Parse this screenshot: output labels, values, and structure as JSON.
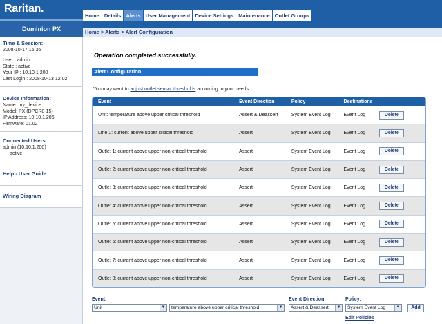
{
  "brand": {
    "logo_text": "Raritan.",
    "device_name": "Dominion PX"
  },
  "nav": {
    "tabs": [
      "Home",
      "Details",
      "Alerts",
      "User Management",
      "Device Settings",
      "Maintenance",
      "Outlet Groups"
    ],
    "active_tab": "Alerts"
  },
  "breadcrumb": {
    "home": "Home",
    "alerts": "Alerts",
    "current": "Alert Configuration",
    "sep": ">"
  },
  "sidebar": {
    "time_session": {
      "title": "Time & Session:",
      "datetime": "2008-10-17 15:36",
      "user": "User : admin",
      "state": "State : active",
      "ip": "Your IP : 10.10.1.200",
      "last_login": "Last Login : 2008-10-13 12:02"
    },
    "device_info": {
      "title": "Device Information:",
      "name": "Name: my_device",
      "model": "Model: PX (DPCR8-15)",
      "ip": "IP Address: 10.10.1.206",
      "firmware": "Firmware: 01.02"
    },
    "connected_users": {
      "title": "Connected Users:",
      "user": "admin (10.10.1.200)",
      "state": "active"
    },
    "help_link": "Help - User Guide",
    "wiring_link": "Wiring Diagram"
  },
  "main": {
    "operation_message": "Operation completed successfully.",
    "section_title": "Alert Configuration",
    "note_prefix": "You may want to ",
    "note_link": "adjust outlet sensor thresholds",
    "note_suffix": " according to your needs."
  },
  "table": {
    "headers": [
      "Event",
      "Event Direction",
      "Policy",
      "Destinations"
    ],
    "delete_label": "Delete",
    "rows": [
      {
        "event": "Unit: temperature above upper critical threshold",
        "direction": "Assert & Deassert",
        "policy": "System Event Log",
        "destination": "Event Log"
      },
      {
        "event": "Line 1: current above upper critical threshold",
        "direction": "Assert",
        "policy": "System Event Log",
        "destination": "Event Log"
      },
      {
        "event": "Outlet 1: current above upper non-critical threshold",
        "direction": "Assert",
        "policy": "System Event Log",
        "destination": "Event Log"
      },
      {
        "event": "Outlet 2: current above upper non-critical threshold",
        "direction": "Assert",
        "policy": "System Event Log",
        "destination": "Event Log"
      },
      {
        "event": "Outlet 3: current above upper non-critical threshold",
        "direction": "Assert",
        "policy": "System Event Log",
        "destination": "Event Log"
      },
      {
        "event": "Outlet 4: current above upper non-critical threshold",
        "direction": "Assert",
        "policy": "System Event Log",
        "destination": "Event Log"
      },
      {
        "event": "Outlet 5: current above upper non-critical threshold",
        "direction": "Assert",
        "policy": "System Event Log",
        "destination": "Event Log"
      },
      {
        "event": "Outlet 6: current above upper non-critical threshold",
        "direction": "Assert",
        "policy": "System Event Log",
        "destination": "Event Log"
      },
      {
        "event": "Outlet 7: current above upper non-critical threshold",
        "direction": "Assert",
        "policy": "System Event Log",
        "destination": "Event Log"
      },
      {
        "event": "Outlet 8: current above upper non-critical threshold",
        "direction": "Assert",
        "policy": "System Event Log",
        "destination": "Event Log"
      }
    ]
  },
  "form": {
    "event_label": "Event:",
    "event_source_value": "Unit",
    "event_value": "temperature above upper critical threshold",
    "direction_label": "Event Direction:",
    "direction_value": "Assert & Deassert",
    "policy_label": "Policy:",
    "policy_value": "System Event Log",
    "add_label": "Add",
    "edit_policies_label": "Edit Policies"
  },
  "colors": {
    "brand_blue": "#1f5fa6",
    "section_blue": "#1f6fc6",
    "row_alt": "#e6e6e6"
  }
}
